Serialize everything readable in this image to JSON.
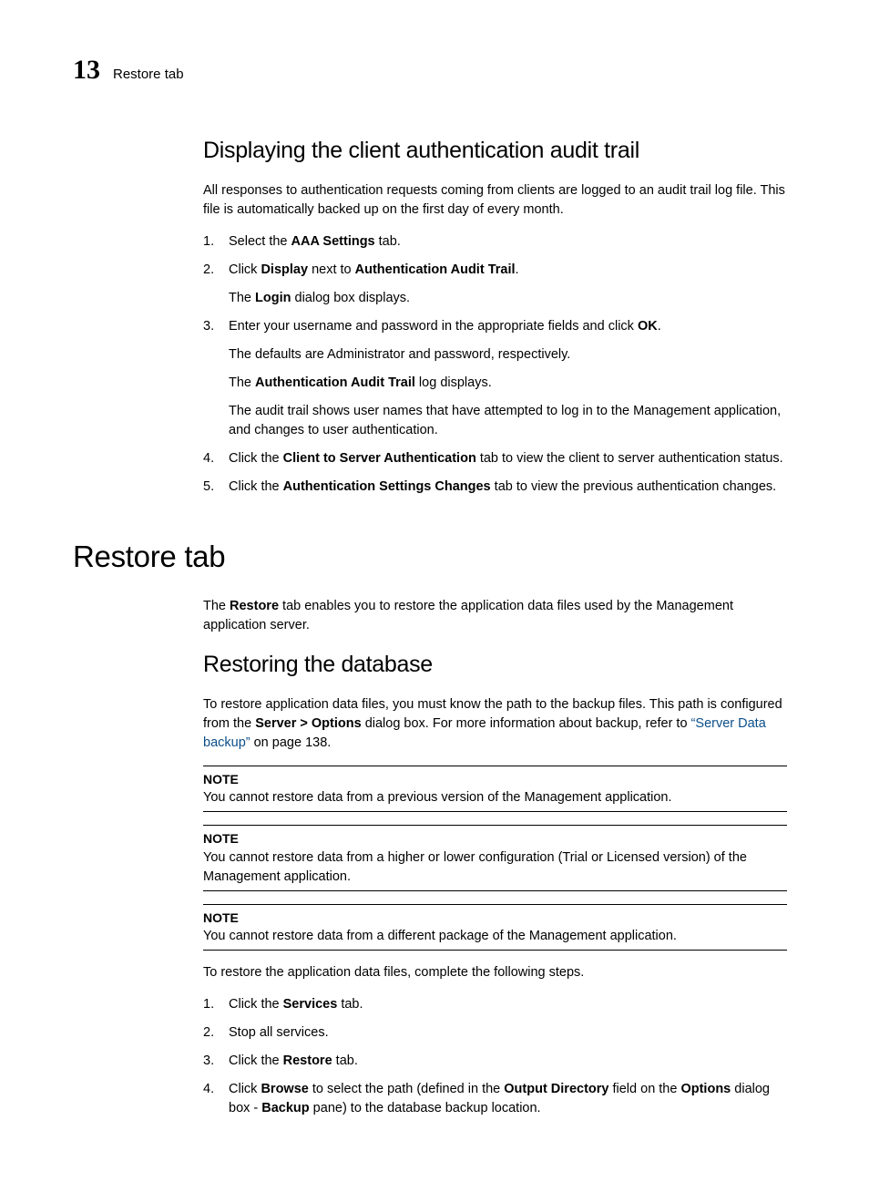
{
  "header": {
    "chapter": "13",
    "title": "Restore tab"
  },
  "sec1": {
    "h": "Displaying the client authentication audit trail",
    "intro": "All responses to authentication requests coming from clients are logged to an audit trail log file. This file is automatically backed up on the first day of every month.",
    "s1": {
      "n": "1.",
      "a": "Select the ",
      "b": "AAA Settings",
      "c": " tab."
    },
    "s2": {
      "n": "2.",
      "a": "Click ",
      "b": "Display",
      "c": " next to ",
      "d": "Authentication Audit Trail",
      "e": ".",
      "sub_a": "The ",
      "sub_b": "Login",
      "sub_c": " dialog box displays."
    },
    "s3": {
      "n": "3.",
      "a": "Enter your username and password in the appropriate fields and click ",
      "b": "OK",
      "c": ".",
      "sub1": "The defaults are Administrator and password, respectively.",
      "sub2_a": "The ",
      "sub2_b": "Authentication Audit Trail",
      "sub2_c": " log displays.",
      "sub3": "The audit trail shows user names that have attempted to log in to the Management application, and changes to user authentication."
    },
    "s4": {
      "n": "4.",
      "a": "Click the ",
      "b": "Client to Server Authentication",
      "c": " tab to view the client to server authentication status."
    },
    "s5": {
      "n": "5.",
      "a": "Click the ",
      "b": "Authentication Settings Changes",
      "c": " tab to view the previous authentication changes."
    }
  },
  "sec2": {
    "h": "Restore tab",
    "intro_a": "The ",
    "intro_b": "Restore",
    "intro_c": " tab enables you to restore the application data files used by the Management application server.",
    "sub_h": "Restoring the database",
    "p1_a": "To restore application data files, you must know the path to the backup files. This path is configured from the ",
    "p1_b": "Server > Options",
    "p1_c": " dialog box. For more information about backup, refer to ",
    "p1_link": "“Server Data backup”",
    "p1_d": " on page 138.",
    "note_label": "NOTE",
    "note1": "You cannot restore data from a previous version of the Management application.",
    "note2": "You cannot restore data from a higher or lower configuration (Trial or Licensed version) of the Management application.",
    "note3": "You cannot restore data from a different package of the Management application.",
    "p2": "To restore the application data files, complete the following steps.",
    "r1": {
      "n": "1.",
      "a": "Click the ",
      "b": "Services",
      "c": " tab."
    },
    "r2": {
      "n": "2.",
      "a": "Stop all services."
    },
    "r3": {
      "n": "3.",
      "a": "Click the ",
      "b": "Restore",
      "c": " tab."
    },
    "r4": {
      "n": "4.",
      "a": "Click ",
      "b": "Browse",
      "c": " to select the path (defined in the ",
      "d": "Output Directory",
      "e": " field on the ",
      "f": "Options",
      "g": " dialog box - ",
      "h": "Backup",
      "i": " pane) to the database backup location."
    }
  }
}
